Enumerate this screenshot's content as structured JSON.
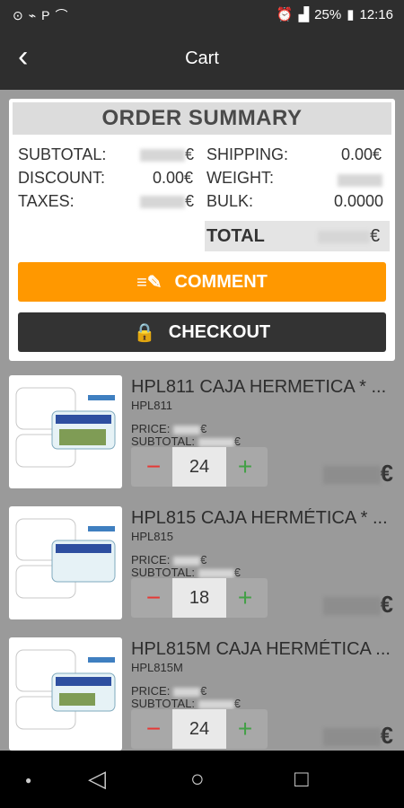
{
  "status_bar": {
    "battery": "25%",
    "time": "12:16"
  },
  "app_bar": {
    "title": "Cart"
  },
  "summary": {
    "heading": "ORDER SUMMARY",
    "subtotal_label": "SUBTOTAL:",
    "subtotal_currency": "€",
    "discount_label": "DISCOUNT:",
    "discount_value": "0.00€",
    "taxes_label": "TAXES:",
    "taxes_currency": "€",
    "shipping_label": "SHIPPING:",
    "shipping_value": "0.00€",
    "weight_label": "WEIGHT:",
    "bulk_label": "BULK:",
    "bulk_value": "0.0000",
    "total_label": "TOTAL",
    "total_currency": "€",
    "comment_label": "COMMENT",
    "checkout_label": "CHECKOUT"
  },
  "items": [
    {
      "name": "HPL811 CAJA HERMETICA * ...",
      "code": "HPL811",
      "price_label": "PRICE:",
      "subtotal_label": "SUBTOTAL:",
      "currency": "€",
      "qty": "24"
    },
    {
      "name": "HPL815 CAJA HERMÉTICA * ...",
      "code": "HPL815",
      "price_label": "PRICE:",
      "subtotal_label": "SUBTOTAL:",
      "currency": "€",
      "qty": "18"
    },
    {
      "name": "HPL815M CAJA HERMÉTICA ...",
      "code": "HPL815M",
      "price_label": "PRICE:",
      "subtotal_label": "SUBTOTAL:",
      "currency": "€",
      "qty": "24"
    }
  ],
  "colors": {
    "accent": "#ff9800",
    "dark": "#333333",
    "minus": "#e53935",
    "plus": "#43a047"
  }
}
